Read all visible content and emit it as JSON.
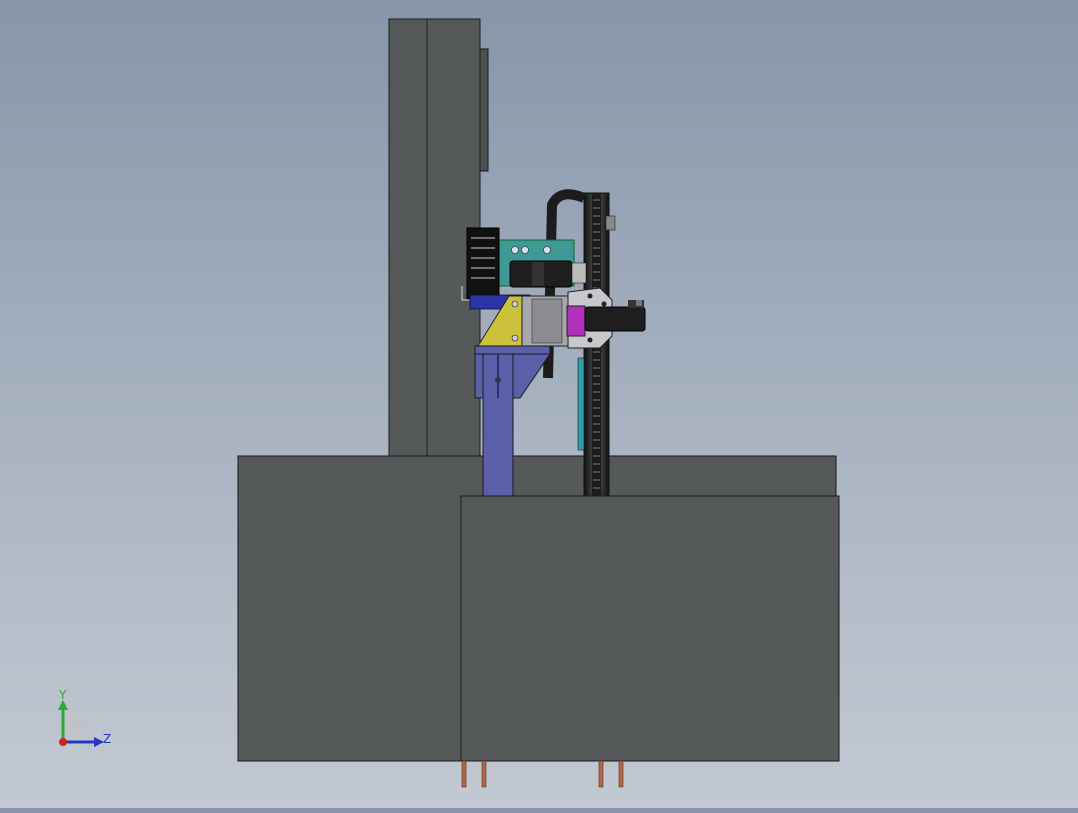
{
  "viewport": {
    "background_top": "#8795aa",
    "background_bottom": "#c3c9d2",
    "body_color": "#555959",
    "edge_color": "#1a1a1a",
    "bracket_color": "#5a5fa8",
    "gusset_color": "#c9c23a",
    "plate_color": "#3f9a96",
    "clamp_color": "#b030b8",
    "rail_color": "#2a2a2a"
  },
  "triad": {
    "y_label": "Y",
    "z_label": "Z",
    "y_color": "#2ea836",
    "z_color": "#2438c8",
    "x_color": "#d02020"
  }
}
